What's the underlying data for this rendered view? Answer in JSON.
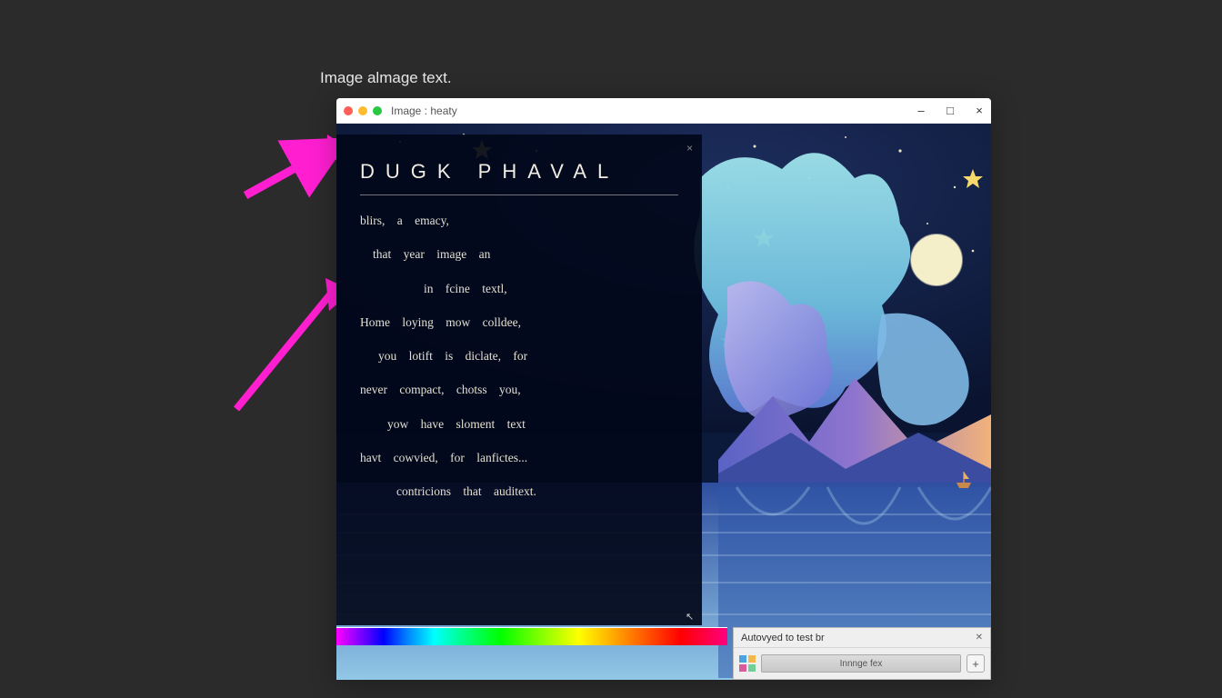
{
  "page": {
    "caption": "Image almage text."
  },
  "window": {
    "title": "Image : heaty",
    "controls": {
      "minimize": "–",
      "maximize": "□",
      "close": "×"
    }
  },
  "overlay": {
    "title": "DUGK PHAVAL",
    "close": "×",
    "poem_lines": [
      "blirs,  a  emacy,",
      "that  year  image  an",
      "in  fcine   textl,",
      "Home    loying    mow    colldee,",
      "you   lotift  is  diclate,   for",
      "never   compact,   chotss   you,",
      "yow  have   sloment   text",
      "havt    cowvied,    for    lanfictes...",
      "contricions   that   auditext."
    ]
  },
  "taskpanel": {
    "header": "Autovyed to test br",
    "close": "✕",
    "input_label": "Innnge fex",
    "add": "+"
  },
  "icons": {
    "cursor": "↖"
  },
  "colors": {
    "arrow": "#ff1fd1",
    "background": "#2b2b2b"
  }
}
